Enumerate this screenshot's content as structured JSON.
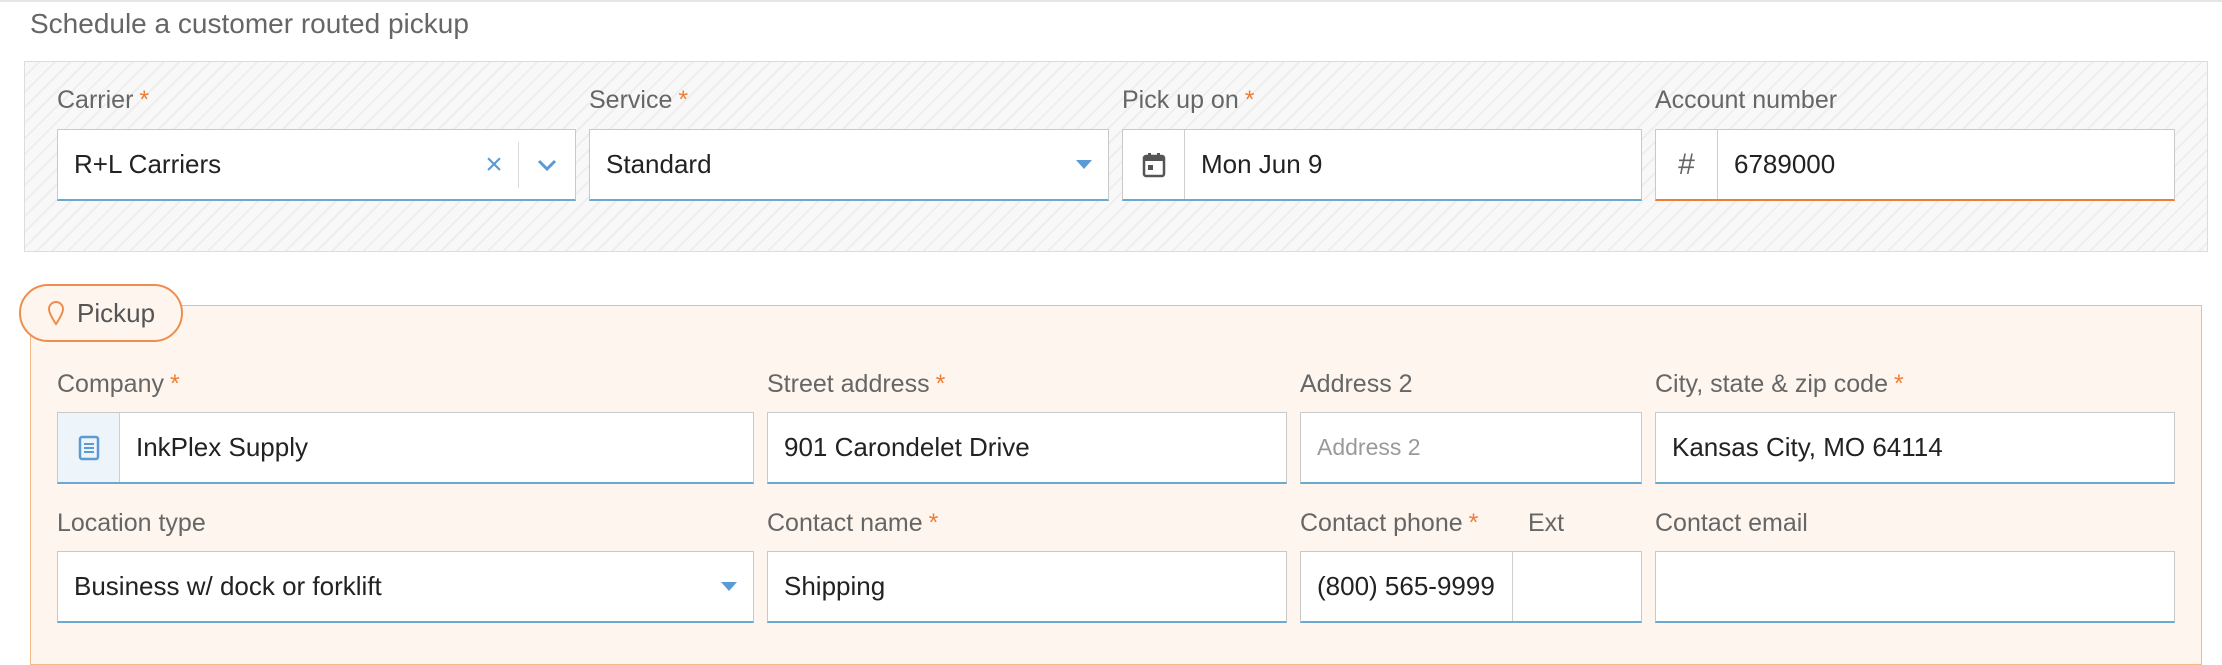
{
  "page": {
    "title": "Schedule a customer routed pickup"
  },
  "colors": {
    "required": "#ef7d33",
    "accent_blue": "#5b9bd5",
    "accent_orange": "#ef8d4c"
  },
  "required_mark": "*",
  "top": {
    "carrier": {
      "label": "Carrier",
      "value": "R+L Carriers",
      "clear_icon": "×",
      "toggle_icon": "chevron-down-icon"
    },
    "service": {
      "label": "Service",
      "value": "Standard"
    },
    "pickup_on": {
      "label": "Pick up on",
      "value": "Mon Jun 9",
      "icon": "calendar-icon"
    },
    "account_number": {
      "label": "Account number",
      "prefix": "#",
      "value": "6789000"
    }
  },
  "pickup": {
    "tab_label": "Pickup",
    "tab_icon": "map-pin-icon",
    "company": {
      "label": "Company",
      "value": "InkPlex Supply",
      "icon": "address-book-icon"
    },
    "street_address": {
      "label": "Street address",
      "value": "901 Carondelet Drive"
    },
    "address2": {
      "label": "Address 2",
      "placeholder": "Address 2",
      "value": ""
    },
    "city_state_zip": {
      "label": "City, state & zip code",
      "value": "Kansas City, MO 64114"
    },
    "location_type": {
      "label": "Location type",
      "value": "Business w/ dock or forklift"
    },
    "contact_name": {
      "label": "Contact name",
      "value": "Shipping"
    },
    "contact_phone": {
      "label": "Contact phone",
      "value": "(800) 565-9999"
    },
    "ext": {
      "label": "Ext",
      "value": ""
    },
    "contact_email": {
      "label": "Contact email",
      "value": ""
    }
  }
}
